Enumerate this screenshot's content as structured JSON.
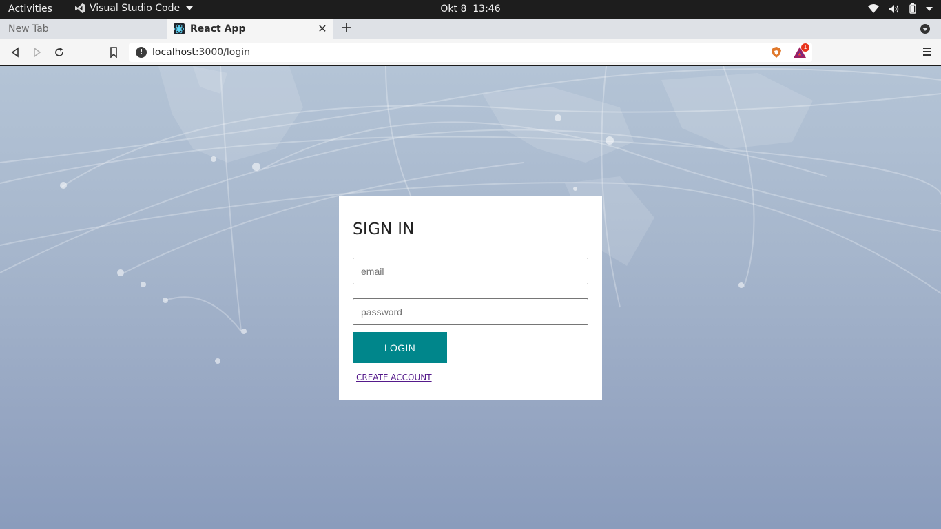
{
  "system_bar": {
    "activities": "Activities",
    "app_name": "Visual Studio Code",
    "date": "Okt 8",
    "time": "13:46"
  },
  "browser": {
    "tabs": [
      {
        "label": "New Tab"
      },
      {
        "label": "React App"
      }
    ],
    "url_host": "localhost",
    "url_rest": ":3000/login",
    "rewards_badge": "1"
  },
  "login_form": {
    "title": "SIGN IN",
    "email_placeholder": "email",
    "password_placeholder": "password",
    "login_label": "LOGIN",
    "create_account_label": "CREATE ACCOUNT"
  },
  "colors": {
    "login_button": "#00868b",
    "visited_link": "#551a8b",
    "brave_orange": "#e0782b"
  }
}
